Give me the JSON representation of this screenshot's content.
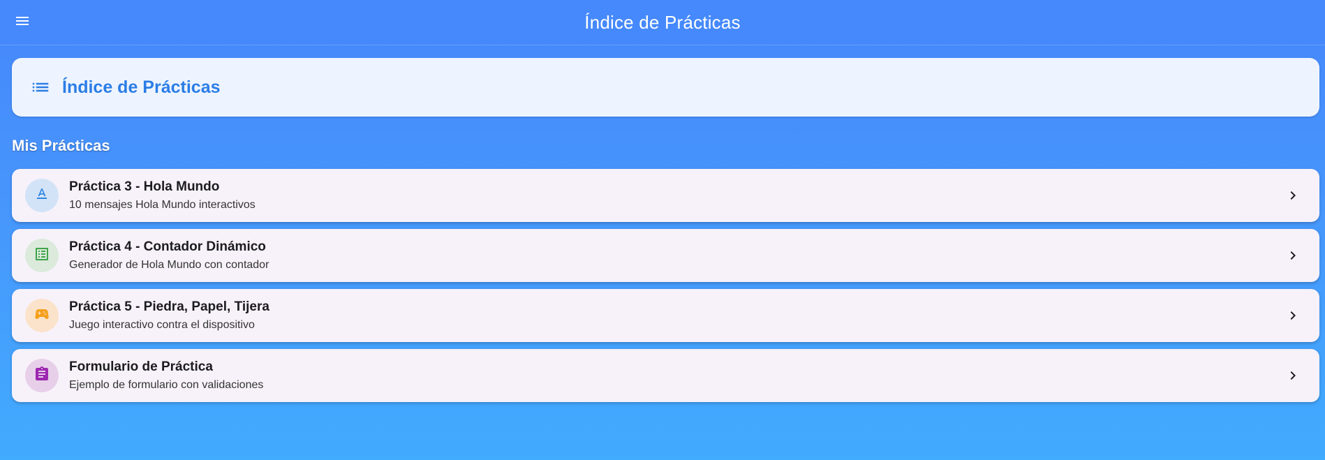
{
  "appbar": {
    "title": "Índice de Prácticas",
    "menu_icon": "menu-icon"
  },
  "header_card": {
    "title": "Índice de Prácticas",
    "icon": "list-icon",
    "color": "#2b7de6"
  },
  "section": {
    "title": "Mis Prácticas"
  },
  "items": [
    {
      "title": "Práctica 3 - Hola Mundo",
      "subtitle": "10 mensajes Hola Mundo interactivos",
      "icon": "font-icon",
      "icon_color": "#2f86e0",
      "avatar_bg": "#d3e3f7"
    },
    {
      "title": "Práctica 4 - Contador Dinámico",
      "subtitle": "Generador de Hola Mundo con contador",
      "icon": "list-alt-icon",
      "icon_color": "#3fa34a",
      "avatar_bg": "#dbeadb"
    },
    {
      "title": "Práctica 5 - Piedra, Papel, Tijera",
      "subtitle": "Juego interactivo contra el dispositivo",
      "icon": "gamepad-icon",
      "icon_color": "#f5a01b",
      "avatar_bg": "#fbe3cb"
    },
    {
      "title": "Formulario de Práctica",
      "subtitle": "Ejemplo de formulario con validaciones",
      "icon": "clipboard-icon",
      "icon_color": "#9c27b0",
      "avatar_bg": "#e8cfe9"
    }
  ]
}
